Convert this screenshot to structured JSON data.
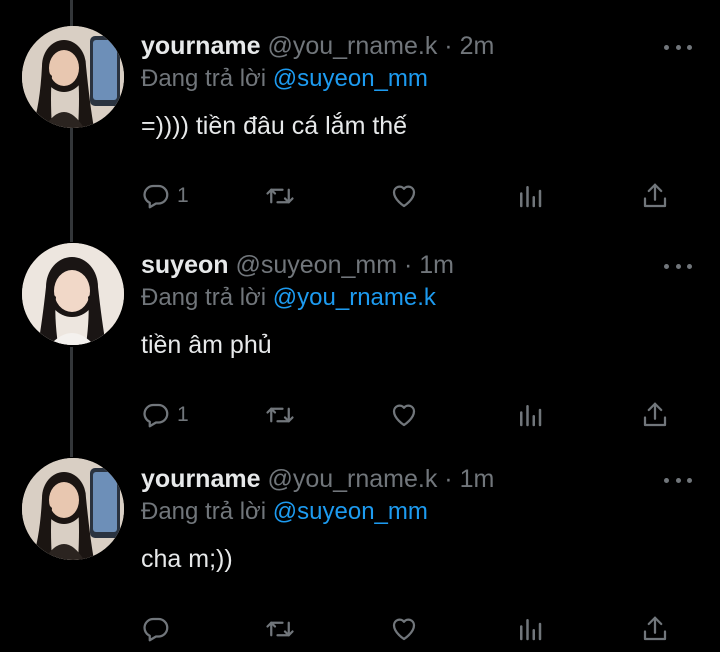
{
  "tweets": [
    {
      "name": "yourname",
      "handle": "@you_rname.k",
      "dot": "·",
      "time": "2m",
      "reply_prefix": "Đang trả lời",
      "reply_to": "@suyeon_mm",
      "text": "=)))) tiền đâu cá lắm thế",
      "reply_count": "1",
      "avatar_icon": "profile-avatar"
    },
    {
      "name": "suyeon",
      "handle": "@suyeon_mm",
      "dot": "·",
      "time": "1m",
      "reply_prefix": "Đang trả lời",
      "reply_to": "@you_rname.k",
      "text": "tiền âm phủ",
      "reply_count": "1",
      "avatar_icon": "profile-avatar"
    },
    {
      "name": "yourname",
      "handle": "@you_rname.k",
      "dot": "·",
      "time": "1m",
      "reply_prefix": "Đang trả lời",
      "reply_to": "@suyeon_mm",
      "text": "cha m;))",
      "reply_count": "",
      "avatar_icon": "profile-avatar"
    }
  ],
  "icons": {
    "reply": "reply-icon",
    "retweet": "retweet-icon",
    "like": "heart-icon",
    "views": "analytics-icon",
    "share": "share-icon",
    "more": "more-icon"
  },
  "colors": {
    "background": "#000000",
    "text": "#e7e9ea",
    "secondary": "#71767b",
    "mention": "#1d9bf0",
    "thread_line": "#333639"
  }
}
